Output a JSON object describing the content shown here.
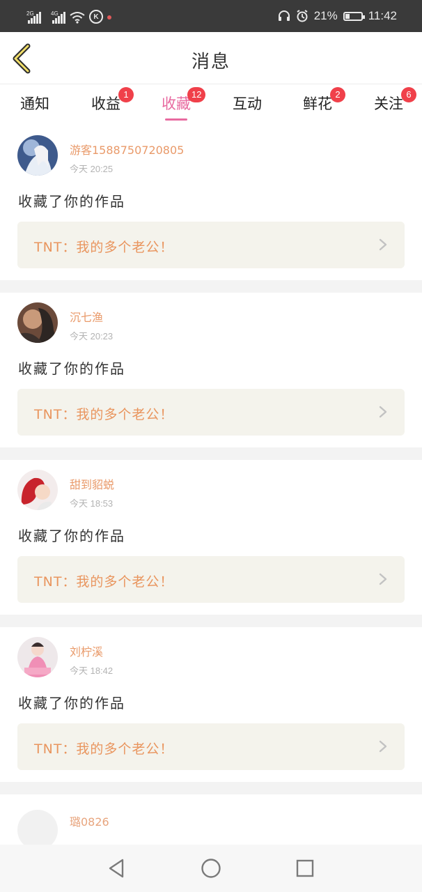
{
  "status_bar": {
    "signal1_label": "2G",
    "signal2_label": "4G",
    "battery_percent": "21%",
    "time": "11:42",
    "colors": {
      "background": "#3a3a3a"
    }
  },
  "header": {
    "title": "消息",
    "back_icon": "chevron-left-icon"
  },
  "tabs": [
    {
      "label": "通知",
      "badge": "",
      "active": false
    },
    {
      "label": "收益",
      "badge": "1",
      "active": false
    },
    {
      "label": "收藏",
      "badge": "12",
      "active": true
    },
    {
      "label": "互动",
      "badge": "",
      "active": false
    },
    {
      "label": "鲜花",
      "badge": "2",
      "active": false
    },
    {
      "label": "关注",
      "badge": "6",
      "active": false
    }
  ],
  "messages": [
    {
      "username": "游客1588750720805",
      "time": "今天 20:25",
      "action": "收藏了你的作品",
      "work_title": "TNT：我的多个老公！"
    },
    {
      "username": "沉七渔",
      "time": "今天 20:23",
      "action": "收藏了你的作品",
      "work_title": "TNT：我的多个老公！"
    },
    {
      "username": "甜到貂蜕",
      "time": "今天 18:53",
      "action": "收藏了你的作品",
      "work_title": "TNT：我的多个老公！"
    },
    {
      "username": "刘柠溪",
      "time": "今天 18:42",
      "action": "收藏了你的作品",
      "work_title": "TNT：我的多个老公！"
    },
    {
      "username": "璐0826"
    }
  ],
  "colors": {
    "accent_pink": "#e86aa0",
    "badge_red": "#f0404a",
    "username_orange": "#e99a6a",
    "work_title_orange": "#e9955e",
    "work_bg": "#f4f3ec"
  },
  "nav": {
    "back_icon": "triangle-back-icon",
    "home_icon": "circle-home-icon",
    "recents_icon": "square-recents-icon"
  }
}
